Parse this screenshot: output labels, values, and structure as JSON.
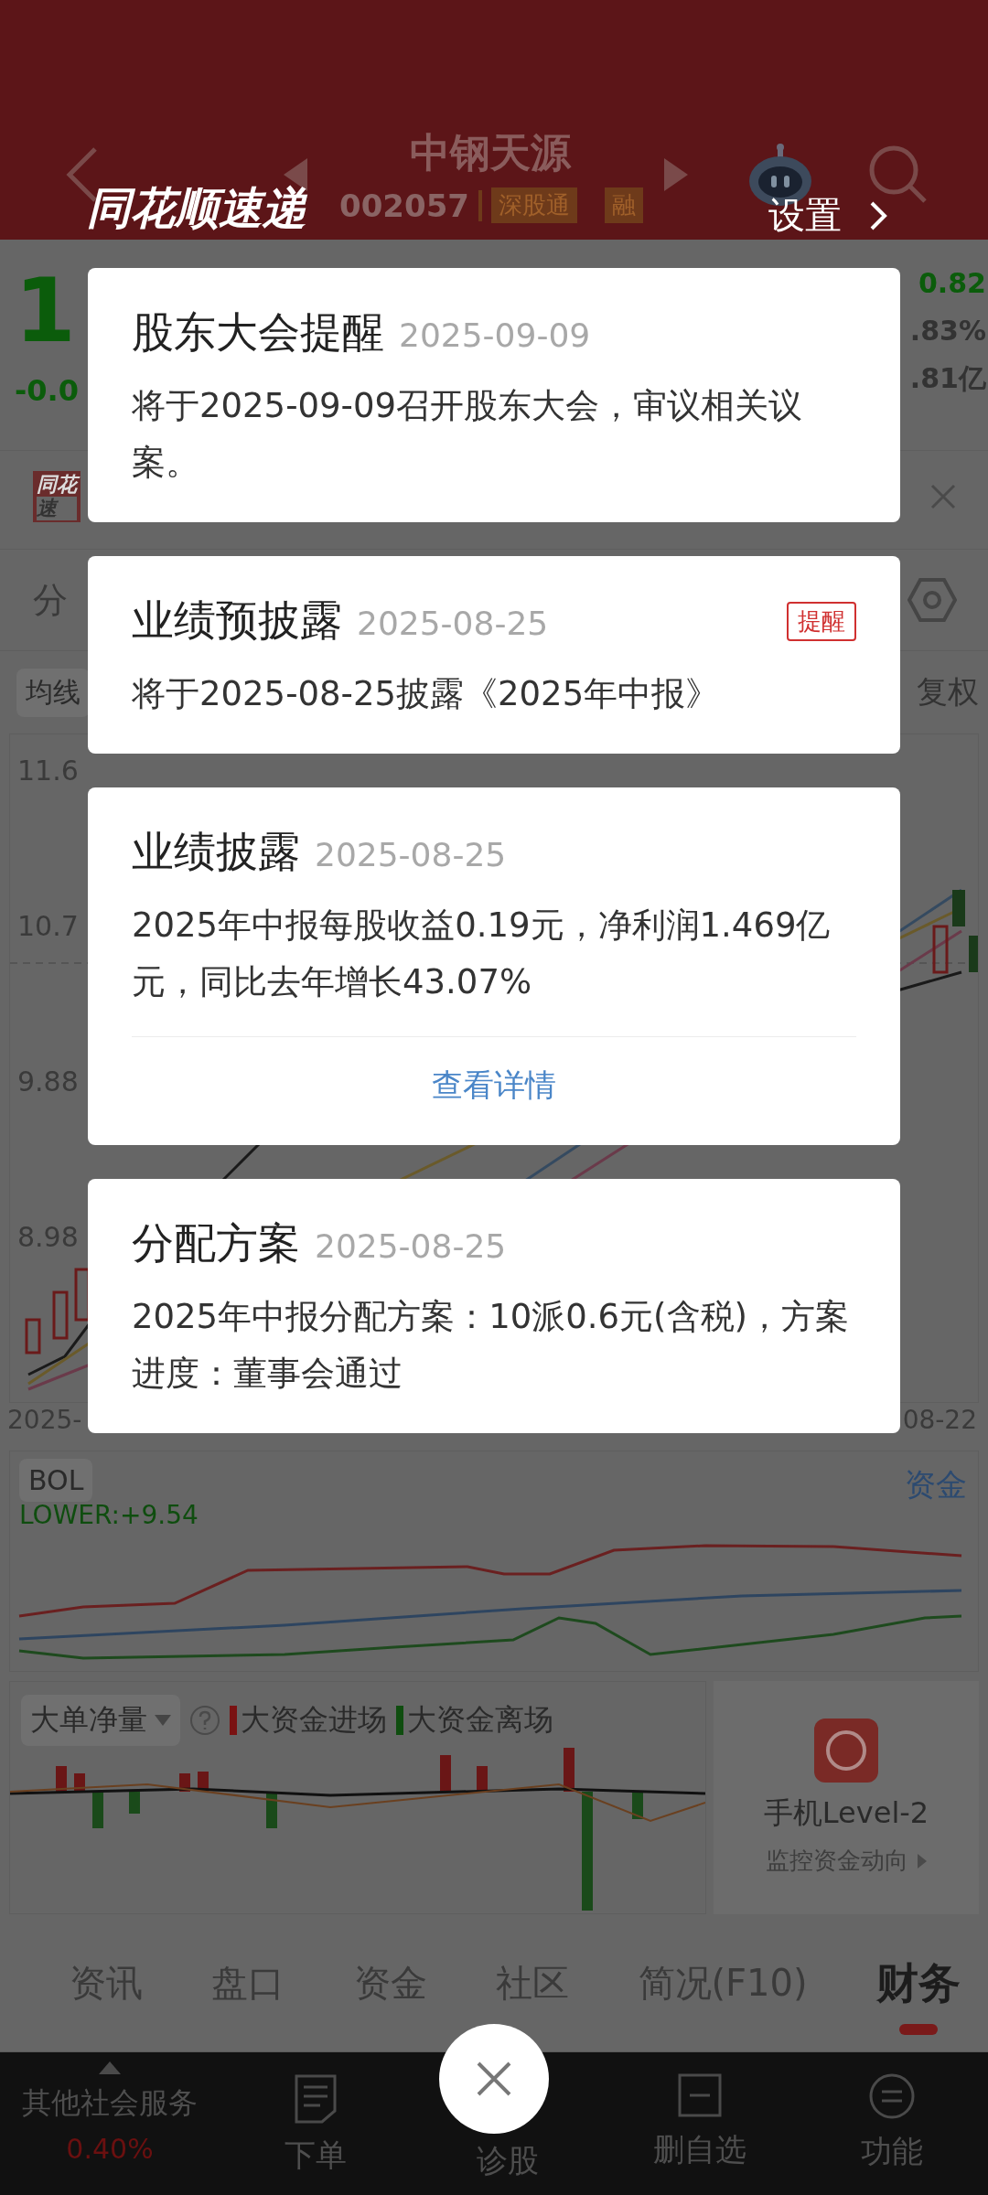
{
  "header": {
    "title": "中钢天源",
    "code": "002057",
    "tags": [
      "深股通",
      "融"
    ]
  },
  "popup_header": {
    "logo": "同花顺速递",
    "settings": "设置"
  },
  "quote": {
    "price": "1",
    "change": "-0.0",
    "stats": [
      "0.82",
      ".83%",
      ".81亿"
    ]
  },
  "banner": {
    "logo_lines": [
      "同花",
      "速"
    ]
  },
  "chart": {
    "period": "分",
    "indicator": "均线",
    "adjust": "复权",
    "y_labels": [
      "11.6",
      "10.7",
      "9.88",
      "8.98"
    ],
    "start_date": "2025-",
    "end_date": "08-22"
  },
  "boll": {
    "name": "BOL",
    "lower": "LOWER:+9.54",
    "link": "资金"
  },
  "flow": {
    "indicator": "大单净量",
    "legend": [
      {
        "label": "大资金进场",
        "color": "#7a1212"
      },
      {
        "label": "大资金离场",
        "color": "#0f4d0f"
      }
    ],
    "promo": {
      "title": "手机Level-2",
      "subtitle": "监控资金动向"
    }
  },
  "tabs": [
    {
      "label": "资讯",
      "selected": false
    },
    {
      "label": "盘口",
      "selected": false
    },
    {
      "label": "资金",
      "selected": false
    },
    {
      "label": "社区",
      "selected": false
    },
    {
      "label": "简况(F10)",
      "selected": false
    },
    {
      "label": "财务",
      "selected": true
    }
  ],
  "bottom_bar": {
    "left": {
      "label": "其他社会服务",
      "change": "0.40%"
    },
    "items": [
      {
        "label": "下单",
        "kind": "order"
      },
      {
        "label": "诊股",
        "kind": "covered"
      },
      {
        "label": "删自选",
        "kind": "remove"
      },
      {
        "label": "功能",
        "kind": "menu"
      }
    ]
  },
  "cards": [
    {
      "title": "股东大会提醒",
      "date": "2025-09-09",
      "body": "将于2025-09-09召开股东大会，审议相关议案。"
    },
    {
      "title": "业绩预披露",
      "date": "2025-08-25",
      "badge": "提醒",
      "body": "将于2025-08-25披露《2025年中报》"
    },
    {
      "title": "业绩披露",
      "date": "2025-08-25",
      "body": "2025年中报每股收益0.19元，净利润1.469亿元，同比去年增长43.07%",
      "link": "查看详情"
    },
    {
      "title": "分配方案",
      "date": "2025-08-25",
      "body": "2025年中报分配方案：10派0.6元(含税)，方案进度：董事会通过"
    }
  ]
}
